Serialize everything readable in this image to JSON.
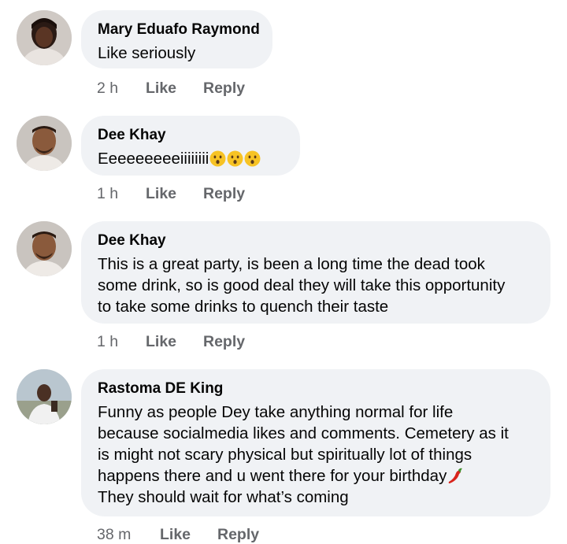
{
  "comments": [
    {
      "author": "Mary Eduafo Raymond",
      "text": "Like seriously",
      "time": "2 h",
      "like_label": "Like",
      "reply_label": "Reply"
    },
    {
      "author": "Dee Khay",
      "text": "Eeeeeeeeeiiiiiiii",
      "emojis": [
        "hushed-face-emoji",
        "hushed-face-emoji",
        "hushed-face-emoji"
      ],
      "time": "1 h",
      "like_label": "Like",
      "reply_label": "Reply"
    },
    {
      "author": "Dee Khay",
      "text_lines": [
        "This is a great party, is been a long time the dead took",
        "some drink, so is good deal they will take this opportunity",
        "to take some drinks to quench their taste"
      ],
      "time": "1 h",
      "like_label": "Like",
      "reply_label": "Reply"
    },
    {
      "author": "Rastoma DE King",
      "text_lines": [
        "Funny as people Dey take anything normal for life",
        "because socialmedia likes and comments. Cemetery as it",
        "is might not scary physical but spiritually lot of things",
        "happens there and u went there for your birthday",
        "They should wait for what’s coming"
      ],
      "inline_emoji": "chili-pepper-emoji",
      "time": "38 m",
      "like_label": "Like",
      "reply_label": "Reply"
    }
  ],
  "colors": {
    "bubble": "#f0f2f5",
    "meta": "#65676b",
    "text": "#050505"
  }
}
